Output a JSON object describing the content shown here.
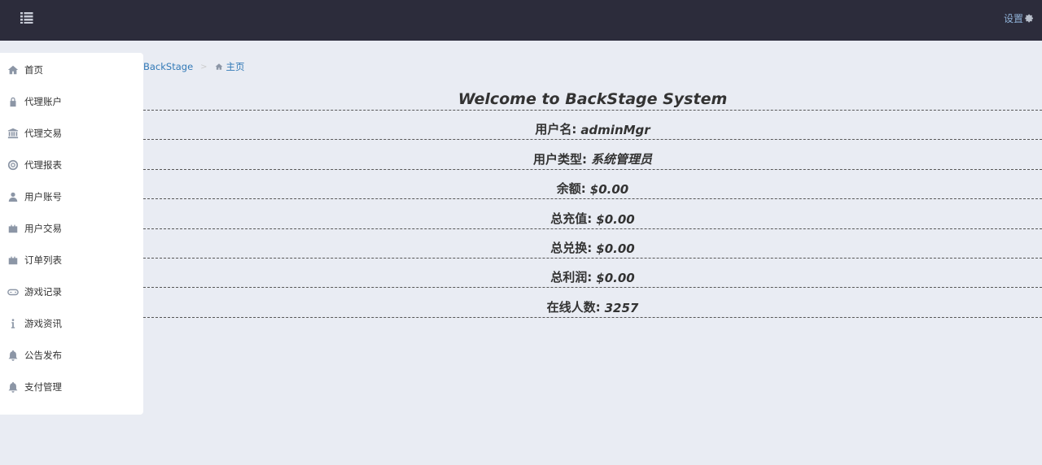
{
  "header": {
    "settings_label": "设置"
  },
  "sidebar": {
    "items": [
      {
        "label": "首页",
        "icon": "home-icon"
      },
      {
        "label": "代理账户",
        "icon": "lock-icon"
      },
      {
        "label": "代理交易",
        "icon": "bank-icon"
      },
      {
        "label": "代理报表",
        "icon": "lifebuoy-icon"
      },
      {
        "label": "用户账号",
        "icon": "user-icon"
      },
      {
        "label": "用户交易",
        "icon": "suitcase-icon"
      },
      {
        "label": "订单列表",
        "icon": "suitcase-icon"
      },
      {
        "label": "游戏记录",
        "icon": "gamepad-icon"
      },
      {
        "label": "游戏资讯",
        "icon": "info-icon"
      },
      {
        "label": "公告发布",
        "icon": "bell-icon"
      },
      {
        "label": "支付管理",
        "icon": "bell-icon"
      }
    ]
  },
  "breadcrumb": {
    "root": "BackStage",
    "current": "主页"
  },
  "main": {
    "title": "Welcome to BackStage System",
    "stats": [
      {
        "label": "用户名:",
        "value": "adminMgr"
      },
      {
        "label": "用户类型:",
        "value": "系统管理员"
      },
      {
        "label": "余额:",
        "value": "$0.00"
      },
      {
        "label": "总充值:",
        "value": "$0.00"
      },
      {
        "label": "总兑换:",
        "value": "$0.00"
      },
      {
        "label": "总利润:",
        "value": "$0.00"
      },
      {
        "label": "在线人数:",
        "value": "3257"
      }
    ]
  },
  "colors": {
    "topbar": "#2c2c3b",
    "background": "#e9ecf3",
    "link": "#337ab7",
    "icon": "#8c96a6"
  }
}
